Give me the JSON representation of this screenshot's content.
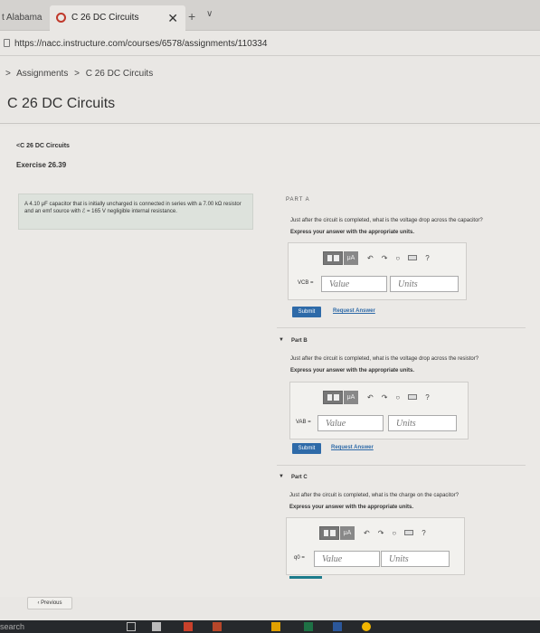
{
  "browser": {
    "prev_tab_title": "t Alabama",
    "active_tab_title": "C 26 DC Circuits",
    "close_glyph": "✕",
    "new_tab_glyph": "+",
    "tab_menu_glyph": "∨",
    "url": "https://nacc.instructure.com/courses/6578/assignments/110334"
  },
  "breadcrumb": {
    "items": [
      "Assignments",
      "C 26 DC Circuits"
    ],
    "separator": ">"
  },
  "page_title": "C 26 DC Circuits",
  "mastering": {
    "back_link": "<C 26 DC Circuits",
    "exercise_title": "Exercise 26.39",
    "problem_text": "A 4.10 μF capacitor that is initially uncharged is connected in series with a 7.00 kΩ resistor and an emf source with ℰ = 165 V negligible internal resistance.",
    "part_a_partial_label": "PART A",
    "parts": [
      {
        "label": "Part A",
        "question": "Just after the circuit is completed, what is the voltage drop across the capacitor?",
        "instruction": "Express your answer with the appropriate units.",
        "field_label": "VCB =",
        "value_placeholder": "Value",
        "units_placeholder": "Units",
        "submit_label": "Submit",
        "request_label": "Request Answer"
      },
      {
        "label": "Part B",
        "question": "Just after the circuit is completed, what is the voltage drop across the resistor?",
        "instruction": "Express your answer with the appropriate units.",
        "field_label": "VAB =",
        "value_placeholder": "Value",
        "units_placeholder": "Units",
        "submit_label": "Submit",
        "request_label": "Request Answer"
      },
      {
        "label": "Part C",
        "question": "Just after the circuit is completed, what is the charge on the capacitor?",
        "instruction": "Express your answer with the appropriate units.",
        "field_label": "q0 =",
        "value_placeholder": "Value",
        "units_placeholder": "Units"
      }
    ],
    "toolbar": {
      "mu_label": "μA",
      "undo_glyph": "↶",
      "redo_glyph": "↷",
      "reset_glyph": "○",
      "help_glyph": "?"
    },
    "prev_label": "‹ Previous"
  },
  "taskbar": {
    "search_text": "search"
  },
  "colors": {
    "submit_blue": "#2e6aa8",
    "accent_teal": "#1e7c8c",
    "problem_box": "#dde2dc"
  }
}
